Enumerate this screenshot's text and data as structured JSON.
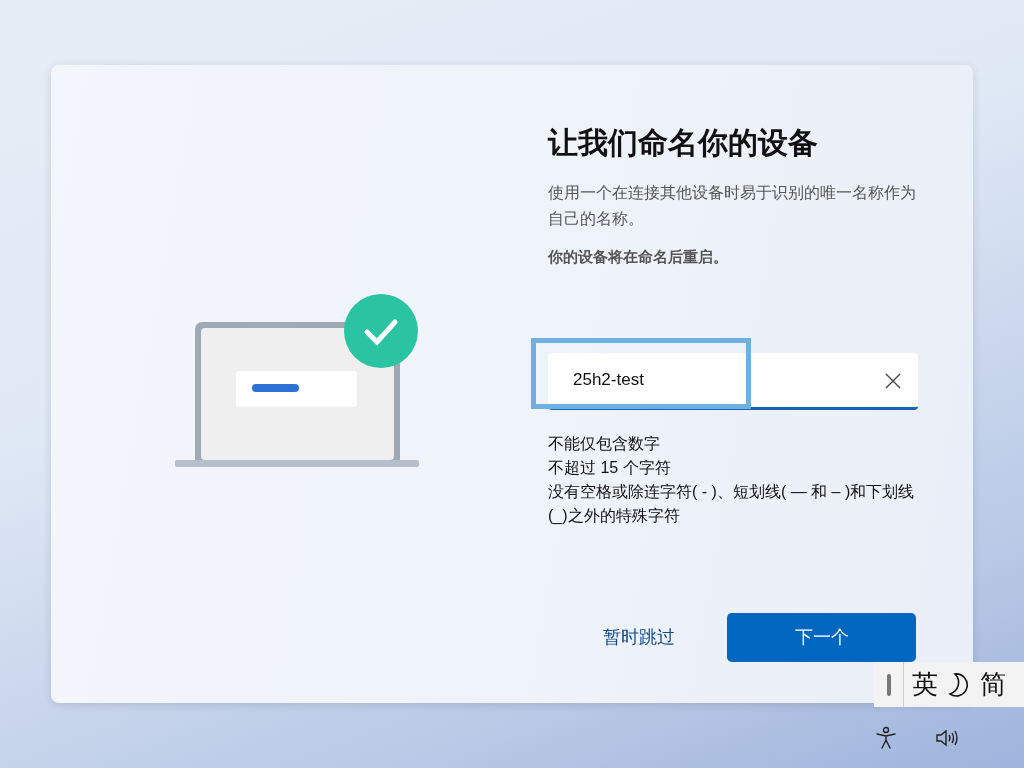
{
  "dialog": {
    "title": "让我们命名你的设备",
    "description": "使用一个在连接其他设备时易于识别的唯一名称作为自己的名称。",
    "note": "你的设备将在命名后重启。",
    "name_field": {
      "value": "25h2-test",
      "focused": true
    },
    "rules": [
      "不能仅包含数字",
      "不超过 15 个字符",
      "没有空格或除连字符( - )、短划线( — 和 – )和下划线(_)之外的特殊字符"
    ],
    "skip_link": "暂时跳过",
    "next_button": "下一个"
  },
  "ime_toolbar": {
    "mode_label": "英",
    "script_label": "简"
  }
}
